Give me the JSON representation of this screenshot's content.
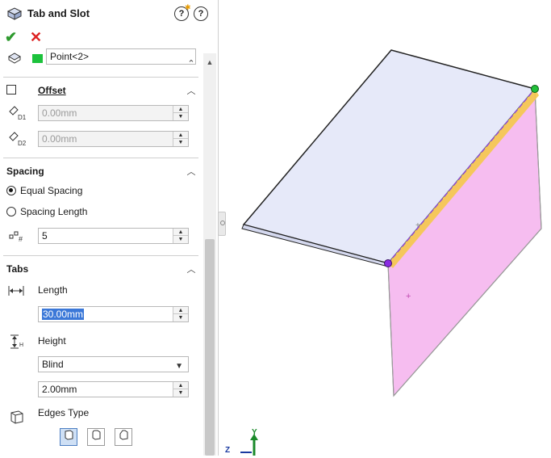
{
  "panel": {
    "title": "Tab and Slot",
    "help_icons": [
      "help-icon",
      "quick-help-icon"
    ],
    "ok_label": "✔",
    "cancel_label": "✕",
    "point_field_value": "Point<2>",
    "offset": {
      "title": "Offset",
      "d1_value": "0.00mm",
      "d2_value": "0.00mm",
      "checked": false
    },
    "spacing": {
      "title": "Spacing",
      "equal_label": "Equal Spacing",
      "length_label": "Spacing Length",
      "selected": "Equal Spacing",
      "count_value": "5"
    },
    "tabs": {
      "title": "Tabs",
      "length_label": "Length",
      "length_value": "30.00mm",
      "height_label": "Height",
      "height_type": "Blind",
      "height_value": "2.00mm",
      "edges_label": "Edges Type"
    }
  },
  "viewport": {
    "triad_y_label": "Y",
    "triad_z_label": "Z"
  },
  "colors": {
    "accent_green": "#2e9a2e",
    "cancel_red": "#d22222",
    "top_face": "#e6e9f9",
    "side_face": "#f6bdf0",
    "highlight_edge": "#f5c84a"
  }
}
